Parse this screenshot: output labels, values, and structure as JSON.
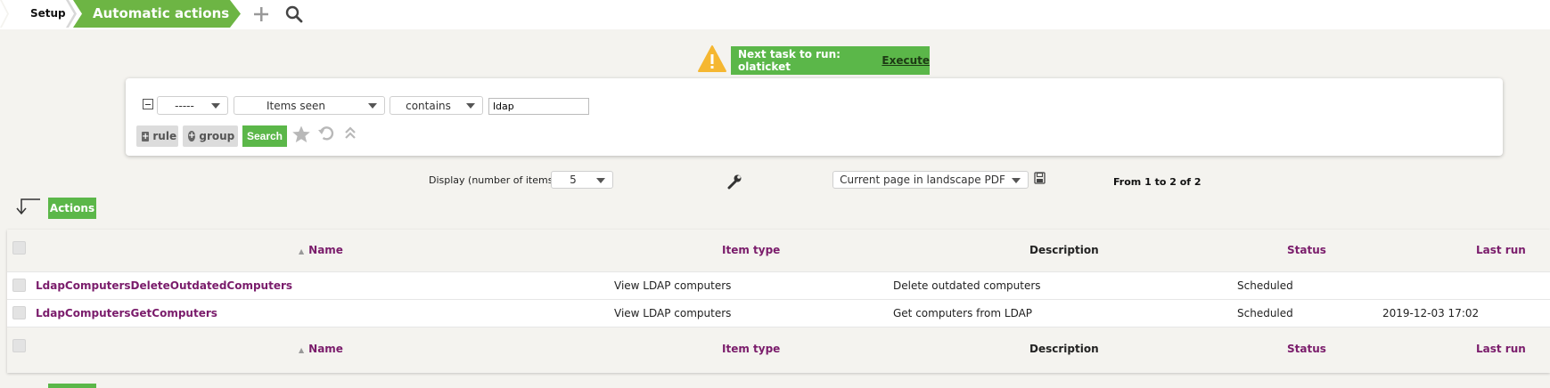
{
  "breadcrumb": {
    "root": "Setup",
    "current": "Automatic actions"
  },
  "header_icons": [
    "plus-icon",
    "search-icon"
  ],
  "next_task": {
    "text": "Next task to run: olaticket",
    "action": "Execute"
  },
  "search": {
    "criteria_link": "-----",
    "field": "Items seen",
    "operator": "contains",
    "value": "ldap",
    "rule_label": "rule",
    "group_label": "group",
    "search_label": "Search"
  },
  "display": {
    "label": "Display (number of items)",
    "count": "5",
    "export_option": "Current page in landscape PDF",
    "pager_text": "From 1 to 2 of 2"
  },
  "actions_label": "Actions",
  "table": {
    "columns": [
      "Name",
      "Item type",
      "Description",
      "Status",
      "Last run"
    ],
    "rows": [
      {
        "name": "LdapComputersDeleteOutdatedComputers",
        "item_type": "View LDAP computers",
        "description": "Delete outdated computers",
        "status": "Scheduled",
        "last_run": ""
      },
      {
        "name": "LdapComputersGetComputers",
        "item_type": "View LDAP computers",
        "description": "Get computers from LDAP",
        "status": "Scheduled",
        "last_run": "2019-12-03 17:02"
      }
    ]
  },
  "colors": {
    "accent_green": "#5bb749",
    "link_purple": "#7a1c6b",
    "warning_yellow": "#f5b731"
  }
}
